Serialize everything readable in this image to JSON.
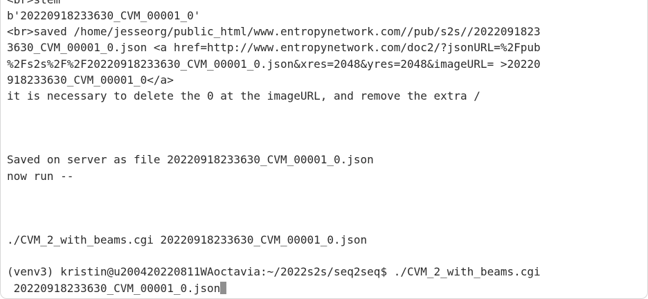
{
  "terminal": {
    "lines": [
      "<br>stem",
      "b'20220918233630_CVM_00001_0'",
      "<br>saved /home/jesseorg/public_html/www.entropynetwork.com//pub/s2s//2022091823",
      "3630_CVM_00001_0.json <a href=http://www.entropynetwork.com/doc2/?jsonURL=%2Fpub",
      "%2Fs2s%2F%2F20220918233630_CVM_00001_0.json&xres=2048&yres=2048&imageURL= >20220",
      "918233630_CVM_00001_0</a>",
      "it is necessary to delete the 0 at the imageURL, and remove the extra /",
      "",
      "",
      "",
      "Saved on server as file 20220918233630_CVM_00001_0.json",
      "now run --",
      "",
      "",
      "",
      "./CVM_2_with_beams.cgi 20220918233630_CVM_00001_0.json",
      "",
      "(venv3) kristin@u200420220811WAoctavia:~/2022s2s/seq2seq$ ./CVM_2_with_beams.cgi",
      " 20220918233630_CVM_00001_0.json"
    ]
  }
}
